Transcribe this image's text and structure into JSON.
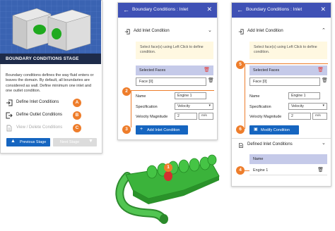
{
  "colors": {
    "accent": "#ee7d2b",
    "header": "#3f51b5",
    "primary_button": "#1565c0",
    "selected_header": "#c5cae9",
    "note_bg": "#fff8e1",
    "model": "#3bb33b"
  },
  "panel1": {
    "stage_title": "BOUNDARY CONDITIONS STAGE",
    "description": "Boundary conditions defines the way fluid enters or leaves the domain. By default, all boundaries are considered as wall. Define minimum one inlet and one outlet condition.",
    "steps": [
      {
        "label": "Define Inlet Conditions",
        "badge": "A",
        "icon": "login-icon"
      },
      {
        "label": "Define Outlet Conditions",
        "badge": "B",
        "icon": "logout-icon"
      },
      {
        "label": "View / Delete Conditions",
        "badge": "C",
        "icon": "document-icon"
      }
    ],
    "previous_button": "Previous Stage",
    "next_button": "Next Stage"
  },
  "panel2": {
    "header_title": "Boundary Conditions : Inlet",
    "section_title": "Add Inlet Condition",
    "note": "Select face(s) using Left Click to define condition.",
    "selected_faces_label": "Selected Faces",
    "face_value": "Face [0]",
    "name_label": "Name",
    "name_value": "Engine 1",
    "spec_label": "Specification",
    "spec_value": "Velocity",
    "mag_label": "Velocity Magnitude",
    "mag_value": "2",
    "mag_unit": "m/s",
    "add_button": "Add Inlet Condition",
    "badges": [
      "2",
      "3"
    ]
  },
  "panel3": {
    "header_title": "Boundary Conditions : Inlet",
    "section_title": "Add Inlet Condition",
    "note": "Select face(s) using Left Click to define condition.",
    "selected_faces_label": "Selected Faces",
    "face_value": "Face [0]",
    "name_label": "Name",
    "name_value": "Engine 1",
    "spec_label": "Specification",
    "spec_value": "Velocity",
    "mag_label": "Velocity Magnitude",
    "mag_value": "2",
    "mag_unit": "m/s",
    "modify_button": "Modify Condition",
    "defined_title": "Defined Inlet Conditions",
    "table_header": "Name",
    "table_rows": [
      "Engine 1"
    ],
    "badges": [
      "5",
      "6",
      "4"
    ]
  },
  "model_badge": "1"
}
